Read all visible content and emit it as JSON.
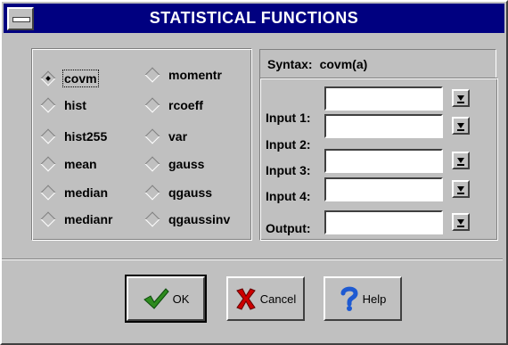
{
  "window": {
    "title": "STATISTICAL FUNCTIONS"
  },
  "functions": {
    "left": [
      "covm",
      "hist",
      "hist255",
      "mean",
      "median",
      "medianr"
    ],
    "right": [
      "momentr",
      "rcoeff",
      "var",
      "gauss",
      "qgauss",
      "qgaussinv"
    ],
    "selected": "covm"
  },
  "syntax": {
    "label": "Syntax:",
    "value": "covm(a)"
  },
  "inputs": [
    {
      "label": "Input 1:",
      "value": ""
    },
    {
      "label": "Input 2:",
      "value": ""
    },
    {
      "label": "Input 3:",
      "value": ""
    },
    {
      "label": "Input 4:",
      "value": ""
    },
    {
      "label": "Output:",
      "value": ""
    }
  ],
  "buttons": {
    "ok": "OK",
    "cancel": "Cancel",
    "help": "Help"
  },
  "colors": {
    "title_bar": "#000080",
    "face": "#c0c0c0",
    "ok_check": "#2e8b1e",
    "cancel_x": "#cc0000",
    "help_q": "#1e5ad2"
  },
  "icons": [
    "system-menu-icon",
    "dropdown-arrow-icon",
    "checkmark-icon",
    "x-icon",
    "question-icon"
  ]
}
